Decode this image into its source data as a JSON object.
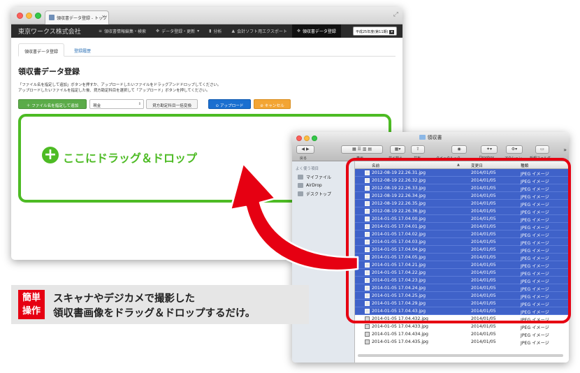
{
  "browser": {
    "tab_title": "領収書データ登録 - トップ",
    "tab_close": "×",
    "brand": "東京ワークス株式会社",
    "nav": [
      {
        "icon": "≡",
        "label": "領収書情報編集・検索"
      },
      {
        "icon": "✥",
        "label": "データ登録・更新"
      },
      {
        "icon": "▮",
        "label": "分析"
      },
      {
        "icon": "▲",
        "label": "会計ソフト用エクスポート"
      },
      {
        "icon": "✥",
        "label": "領収書データ登録"
      }
    ],
    "era_select": "平成25年度(第11期)",
    "tabs": [
      {
        "label": "領収書データ登録"
      },
      {
        "label": "登録履歴"
      }
    ],
    "page_title": "領収書データ登録",
    "desc_line1": "「ファイル名を指定して追加」ボタンを押すか、アップロードしたいファイルをドラッグアンドドロップしてください。",
    "desc_line2": "アップロードしたいファイルを指定した後、貸方勘定科目を選択して「アップロード」ボタンを押してください。",
    "btn_add": "＋ ファイル名を指定して追加",
    "select_account": "現金",
    "btn_bulk": "貸方勘定科目一括変換",
    "btn_upload": "⊙ アップロード",
    "btn_cancel": "⊘ キャンセル",
    "drop_plus": "+",
    "drop_text": "ここにドラッグ＆ドロップ"
  },
  "finder": {
    "title": "領収書",
    "toolbar_labels": [
      "戻る",
      "表示",
      "並べ替え",
      "共有",
      "クイックルック",
      "Dropbox",
      "アクション",
      "新規フォルダ"
    ],
    "sidebar_head": "よく使う項目",
    "sidebar_items": [
      "マイファイル",
      "AirDrop",
      "デスクトップ"
    ],
    "headers": {
      "name": "名前",
      "date": "変更日",
      "kind": "種類"
    },
    "rows": [
      {
        "name": "2012-08-19 22.26.31.jpg",
        "date": "2014/01/05",
        "kind": "JPEG イメージ",
        "selected": true
      },
      {
        "name": "2012-08-19 22.26.32.jpg",
        "date": "2014/01/05",
        "kind": "JPEG イメージ",
        "selected": true
      },
      {
        "name": "2012-08-19 22.26.33.jpg",
        "date": "2014/01/05",
        "kind": "JPEG イメージ",
        "selected": true
      },
      {
        "name": "2012-08-19 22.26.34.jpg",
        "date": "2014/01/05",
        "kind": "JPEG イメージ",
        "selected": true
      },
      {
        "name": "2012-08-19 22.26.35.jpg",
        "date": "2014/01/05",
        "kind": "JPEG イメージ",
        "selected": true
      },
      {
        "name": "2012-08-19 22.26.36.jpg",
        "date": "2014/01/05",
        "kind": "JPEG イメージ",
        "selected": true
      },
      {
        "name": "2014-01-05 17.04.00.jpg",
        "date": "2014/01/05",
        "kind": "JPEG イメージ",
        "selected": true
      },
      {
        "name": "2014-01-05 17.04.01.jpg",
        "date": "2014/01/05",
        "kind": "JPEG イメージ",
        "selected": true
      },
      {
        "name": "2014-01-05 17.04.02.jpg",
        "date": "2014/01/05",
        "kind": "JPEG イメージ",
        "selected": true
      },
      {
        "name": "2014-01-05 17.04.03.jpg",
        "date": "2014/01/05",
        "kind": "JPEG イメージ",
        "selected": true
      },
      {
        "name": "2014-01-05 17.04.04.jpg",
        "date": "2014/01/05",
        "kind": "JPEG イメージ",
        "selected": true
      },
      {
        "name": "2014-01-05 17.04.05.jpg",
        "date": "2014/01/05",
        "kind": "JPEG イメージ",
        "selected": true
      },
      {
        "name": "2014-01-05 17.04.21.jpg",
        "date": "2014/01/05",
        "kind": "JPEG イメージ",
        "selected": true
      },
      {
        "name": "2014-01-05 17.04.22.jpg",
        "date": "2014/01/05",
        "kind": "JPEG イメージ",
        "selected": true
      },
      {
        "name": "2014-01-05 17.04.23.jpg",
        "date": "2014/01/05",
        "kind": "JPEG イメージ",
        "selected": true
      },
      {
        "name": "2014-01-05 17.04.24.jpg",
        "date": "2014/01/05",
        "kind": "JPEG イメージ",
        "selected": true
      },
      {
        "name": "2014-01-05 17.04.25.jpg",
        "date": "2014/01/05",
        "kind": "JPEG イメージ",
        "selected": true
      },
      {
        "name": "2014-01-05 17.04.29.jpg",
        "date": "2014/01/05",
        "kind": "JPEG イメージ",
        "selected": true
      },
      {
        "name": "2014-01-05 17.04.43.jpg",
        "date": "2014/01/05",
        "kind": "JPEG イメージ",
        "selected": true
      },
      {
        "name": "2014-01-05 17.04.432.jpg",
        "date": "2014/01/05",
        "kind": "JPEG イメージ",
        "selected": false
      },
      {
        "name": "2014-01-05 17.04.433.jpg",
        "date": "2014/01/05",
        "kind": "JPEG イメージ",
        "selected": false
      },
      {
        "name": "2014-01-05 17.04.434.jpg",
        "date": "2014/01/05",
        "kind": "JPEG イメージ",
        "selected": false
      },
      {
        "name": "2014-01-05 17.04.435.jpg",
        "date": "2014/01/05",
        "kind": "JPEG イメージ",
        "selected": false
      }
    ]
  },
  "caption": {
    "badge_line1": "簡単",
    "badge_line2": "操作",
    "line1": "スキャナやデジカメで撮影した",
    "line2": "領収書画像をドラッグ＆ドロップするだけ。"
  },
  "colors": {
    "accent_green": "#4dbb24",
    "highlight_red": "#e60012",
    "selection_blue": "#3f62c9"
  }
}
